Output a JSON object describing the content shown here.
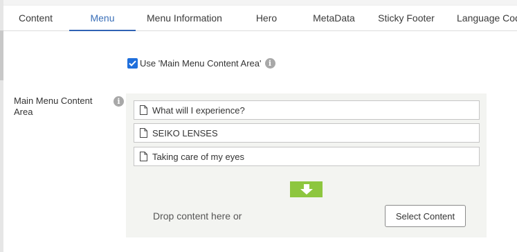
{
  "tabs": [
    {
      "label": "Content"
    },
    {
      "label": "Menu"
    },
    {
      "label": "Menu Information"
    },
    {
      "label": "Hero"
    },
    {
      "label": "MetaData"
    },
    {
      "label": "Sticky Footer"
    },
    {
      "label": "Language Code"
    }
  ],
  "active_tab": "Menu",
  "use_main_menu": {
    "label": "Use 'Main Menu Content Area'",
    "checked": true
  },
  "main_menu_field": {
    "label": "Main Menu Content Area",
    "items": [
      {
        "label": "What will I experience?"
      },
      {
        "label": "SEIKO LENSES"
      },
      {
        "label": "Taking care of my eyes"
      }
    ],
    "drop_text": "Drop content here or",
    "select_button": "Select Content"
  },
  "colors": {
    "accent": "#2f62b4",
    "checkbox": "#1f6fdc",
    "drop_arrow": "#8dc63f",
    "drop_area_bg": "#f3f4f1"
  },
  "icons": {
    "info": "info-icon",
    "document": "document-icon",
    "arrow": "arrow-down-icon",
    "check": "checkmark-icon"
  }
}
